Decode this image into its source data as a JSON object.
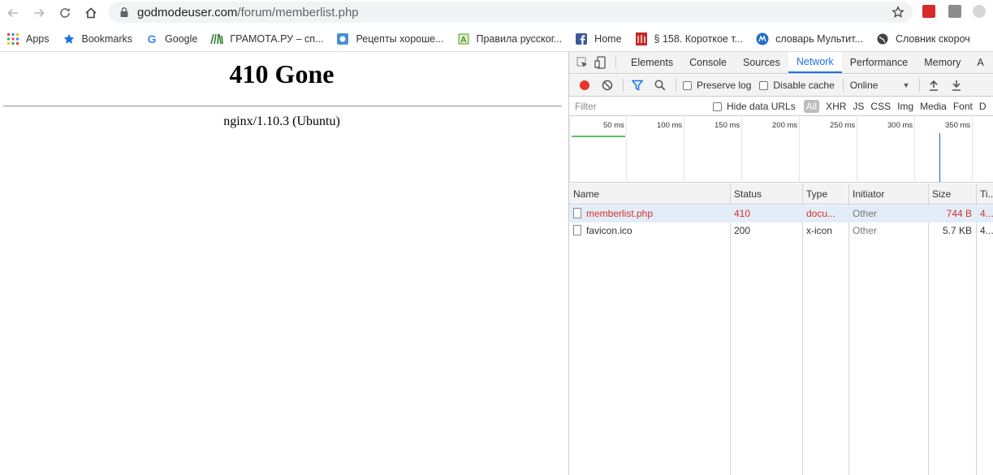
{
  "browser": {
    "url_host": "godmodeuser.com",
    "url_path": "/forum/memberlist.php"
  },
  "bookmarks": [
    {
      "label": "Apps",
      "icon": "apps-grid-icon"
    },
    {
      "label": "Bookmarks",
      "icon": "star-icon"
    },
    {
      "label": "Google",
      "icon": "google-icon"
    },
    {
      "label": "ГРАМОТА.РУ – сп...",
      "icon": "gramota-icon"
    },
    {
      "label": "Рецепты хороше...",
      "icon": "recipes-icon"
    },
    {
      "label": "Правила русског...",
      "icon": "rules-icon"
    },
    {
      "label": "Home",
      "icon": "facebook-icon"
    },
    {
      "label": "§ 158. Короткое т...",
      "icon": "als-icon"
    },
    {
      "label": "словарь Мультит...",
      "icon": "multitran-icon"
    },
    {
      "label": "Словник скороч",
      "icon": "globe-icon"
    }
  ],
  "page": {
    "heading": "410 Gone",
    "server": "nginx/1.10.3 (Ubuntu)"
  },
  "devtools": {
    "tabs": [
      "Elements",
      "Console",
      "Sources",
      "Network",
      "Performance",
      "Memory",
      "A"
    ],
    "active_tab": "Network",
    "preserve_log": "Preserve log",
    "disable_cache": "Disable cache",
    "throttling": "Online",
    "filter_placeholder": "Filter",
    "hide_data_urls": "Hide data URLs",
    "types": [
      "All",
      "XHR",
      "JS",
      "CSS",
      "Img",
      "Media",
      "Font",
      "D"
    ],
    "timeline_ticks": [
      "50 ms",
      "100 ms",
      "150 ms",
      "200 ms",
      "250 ms",
      "300 ms",
      "350 ms"
    ],
    "columns": [
      "Name",
      "Status",
      "Type",
      "Initiator",
      "Size",
      "Ti..."
    ],
    "rows": [
      {
        "name": "memberlist.php",
        "status": "410",
        "type": "docu...",
        "initiator": "Other",
        "size": "744 B",
        "time": "4..."
      },
      {
        "name": "favicon.ico",
        "status": "200",
        "type": "x-icon",
        "initiator": "Other",
        "size": "5.7 KB",
        "time": "4..."
      }
    ]
  },
  "colors": {
    "accent": "#1a73e8",
    "error": "#d93025",
    "record": "#e8352c"
  }
}
